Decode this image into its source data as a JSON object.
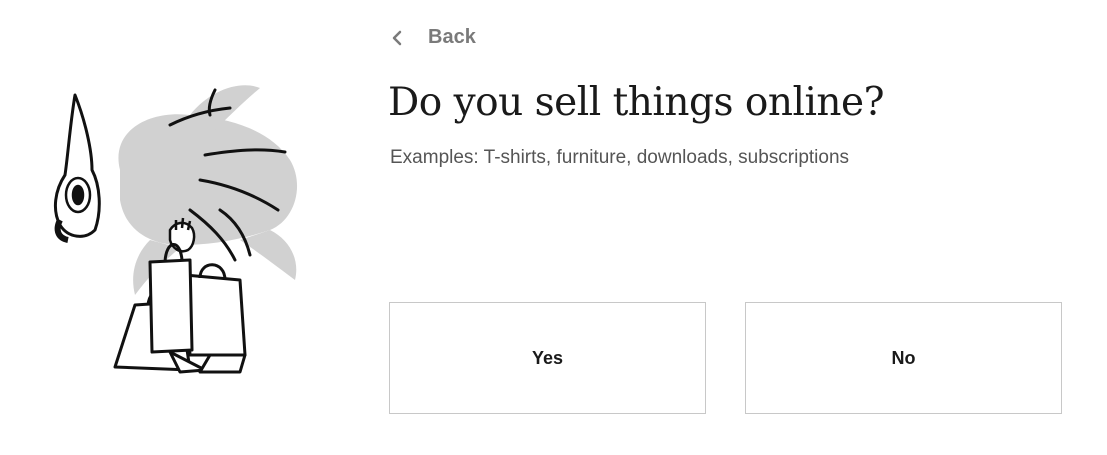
{
  "nav": {
    "back_label": "Back"
  },
  "question": {
    "title": "Do you sell things online?",
    "subtitle": "Examples: T-shirts, furniture, downloads, subscriptions"
  },
  "choices": [
    {
      "label": "Yes"
    },
    {
      "label": "No"
    }
  ],
  "illustration": {
    "icon": "bird-with-shopping-bags-illustration"
  },
  "colors": {
    "background": "#ffffff",
    "text_primary": "#1a1a1a",
    "text_muted": "#7a7a7a",
    "border": "#c8c8c8"
  }
}
